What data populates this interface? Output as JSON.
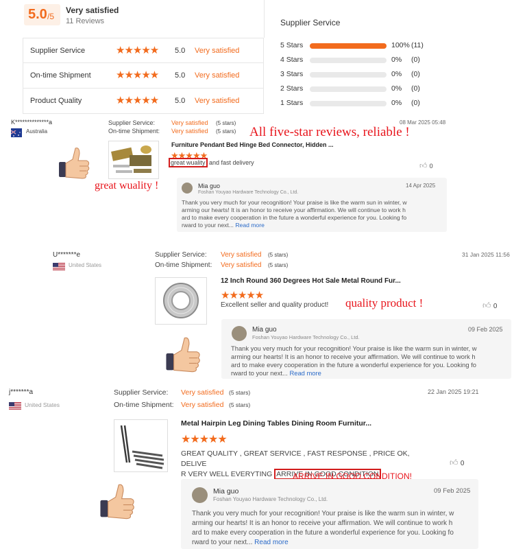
{
  "summary": {
    "score": "5.0",
    "score_suffix": "/5",
    "label": "Very satisfied",
    "reviews": "11 Reviews"
  },
  "ratings": [
    {
      "label": "Supplier Service",
      "value": "5.0",
      "text": "Very satisfied"
    },
    {
      "label": "On-time Shipment",
      "value": "5.0",
      "text": "Very satisfied"
    },
    {
      "label": "Product Quality",
      "value": "5.0",
      "text": "Very satisfied"
    }
  ],
  "breakdown": {
    "title": "Supplier Service",
    "rows": [
      {
        "label": "5 Stars",
        "percent": "100%",
        "count": "(11)",
        "fill": 1.0
      },
      {
        "label": "4 Stars",
        "percent": "0%",
        "count": "(0)",
        "fill": 0
      },
      {
        "label": "3 Stars",
        "percent": "0%",
        "count": "(0)",
        "fill": 0
      },
      {
        "label": "2 Stars",
        "percent": "0%",
        "count": "(0)",
        "fill": 0
      },
      {
        "label": "1 Stars",
        "percent": "0%",
        "count": "(0)",
        "fill": 0
      }
    ]
  },
  "stars_glyph": "★★★★★",
  "reviews": [
    {
      "user": "K**************a",
      "country": "Australia",
      "supplier_label": "Supplier Service:",
      "supplier_value": "Very satisfied",
      "supplier_stars": "(5 stars)",
      "shipment_label": "On-time Shipment:",
      "shipment_value": "Very satisfied",
      "shipment_stars": "(5 stars)",
      "date": "08 Mar 2025 05:48",
      "product": "Furniture Pendant Bed Hinge Bed Connector, Hidden ...",
      "comment_hl": "great wuality",
      "comment_rest": " and fast delivery",
      "likes": "0",
      "reply_name": "Mia guo",
      "reply_company": "Foshan Youyao Hardware Technology Co., Ltd.",
      "reply_date": "14 Apr 2025",
      "reply_lines": [
        "Thank you very much for your recognition! Your praise is like the warm sun in winter, w",
        "arming our hearts! It is an honor to receive your affirmation. We will continue to work h",
        "ard to make every cooperation in the future a wonderful experience for you. Looking fo",
        "rward to your next..."
      ],
      "read_more": "Read more"
    },
    {
      "user": "U*******e",
      "country": "United States",
      "supplier_label": "Supplier Service:",
      "supplier_value": "Very satisfied",
      "supplier_stars": "(5 stars)",
      "shipment_label": "On-time Shipment:",
      "shipment_value": "Very satisfied",
      "shipment_stars": "(5 stars)",
      "date": "31 Jan 2025 11:56",
      "product": "12 Inch Round 360 Degrees Hot Sale Metal Round Fur...",
      "comment": "Excellent seller and quality product!",
      "likes": "0",
      "reply_name": "Mia guo",
      "reply_company": "Foshan Youyao Hardware Technology Co., Ltd.",
      "reply_date": "09 Feb 2025",
      "reply_lines": [
        "Thank you very much for your recognition! Your praise is like the warm sun in winter, w",
        "arming our hearts! It is an honor to receive your affirmation. We will continue to work h",
        "ard to make every cooperation in the future a wonderful experience for you. Looking fo",
        "rward to your next..."
      ],
      "read_more": "Read more"
    },
    {
      "user": "j*******a",
      "country": "United States",
      "supplier_label": "Supplier Service:",
      "supplier_value": "Very satisfied",
      "supplier_stars": "(5 stars)",
      "shipment_label": "On-time Shipment:",
      "shipment_value": "Very satisfied",
      "shipment_stars": "(5 stars)",
      "date": "22 Jan 2025 19:21",
      "product": "Metal Hairpin Leg Dining Tables Dining Room Furnitur...",
      "comment_line1": "GREAT QUALITY , GREAT SERVICE , FAST RESPONSE , PRICE OK,  DELIVE",
      "comment_line2a": "R VERY WELL EVERYTING ",
      "comment_hl": "ARRIVE IN GOOD CONDITION",
      "likes": "0",
      "reply_name": "Mia guo",
      "reply_company": "Foshan Youyao Hardware Technology Co., Ltd.",
      "reply_date": "09 Feb 2025",
      "reply_lines": [
        "Thank you very much for your recognition! Your praise is like the warm sun in winter, w",
        "arming our hearts! It is an honor to receive your affirmation. We will continue to work h",
        "ard to make every cooperation in the future a wonderful experience for you. Looking fo",
        "rward to your next..."
      ],
      "read_more": "Read more"
    }
  ],
  "annotations": {
    "headline": "All five-star reviews, reliable !",
    "note1": "great wuality !",
    "note2": "quality product !",
    "note3": "ARRIVE IN GOOD CONDITION!"
  },
  "colors": {
    "accent": "#f26b1d",
    "annotation_red": "#e8141b",
    "reply_bg": "#f5f5f5",
    "link": "#2a6ac8"
  }
}
